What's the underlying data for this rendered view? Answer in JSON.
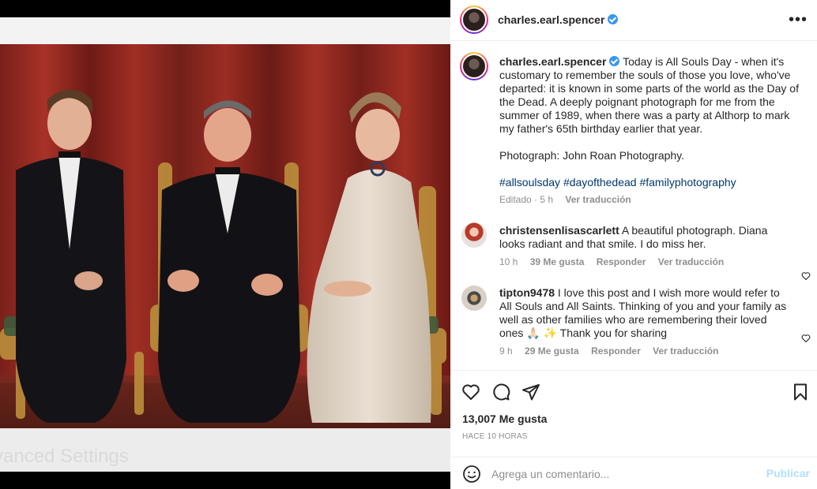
{
  "media": {
    "ghost_text": "vanced Settings",
    "photo_alt": "Photograph of three people seated on gilded chairs"
  },
  "post": {
    "author": "charles.earl.spencer",
    "caption": {
      "text": "Today is All Souls Day - when it's customary to remember the souls of those you love, who've departed: it is known in some parts of the world as the Day of the Dead. A deeply poignant photograph for me from the summer of 1989, when there was a party at Althorp to mark my father's 65th birthday earlier that year.",
      "credit": "Photograph: John Roan Photography.",
      "hashtags": "#allsoulsday #dayofthedead #familyphotography",
      "edited": "Editado · 5 h",
      "translate": "Ver traducción"
    },
    "comments": [
      {
        "user": "christensenlisascarlett",
        "text": "A beautiful photograph. Diana looks radiant and that smile. I do miss her.",
        "time": "10 h",
        "likes": "39 Me gusta",
        "reply": "Responder",
        "translate": "Ver traducción"
      },
      {
        "user": "tipton9478",
        "text": "I love this post and I wish more would refer to All Souls and All Saints. Thinking of you and your family as well as other families who are remembering their loved ones 🙏🏻 ✨ Thank you for sharing",
        "time": "9 h",
        "likes": "29 Me gusta",
        "reply": "Responder",
        "translate": "Ver traducción"
      }
    ],
    "likes": "13,007 Me gusta",
    "posted": "HACE 10 HORAS",
    "add_comment": {
      "placeholder": "Agrega un comentario...",
      "submit": "Publicar"
    }
  },
  "icons": {
    "header_more": "more-horizontal-icon",
    "like": "heart-icon",
    "comment": "comment-bubble-icon",
    "share": "paper-plane-icon",
    "save": "bookmark-icon",
    "emoji": "emoji-face-icon",
    "verified": "verified-badge-icon"
  },
  "colors": {
    "accent": "#0095f6",
    "hashtag": "#00376b",
    "verified": "#3897f0",
    "muted": "#8e8e8e",
    "publish_disabled": "#b2dffc"
  }
}
